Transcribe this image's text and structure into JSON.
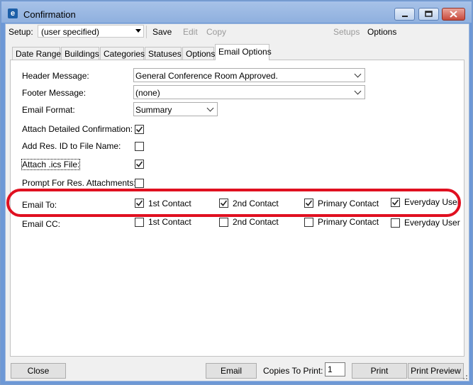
{
  "window": {
    "title": "Confirmation",
    "app_icon": "e",
    "controls": {
      "minimize": "minimize-icon",
      "maximize": "maximize-icon",
      "close": "close-icon"
    }
  },
  "toolbar": {
    "setup_label": "Setup:",
    "setup_value": "(user specified)",
    "save": "Save",
    "edit": "Edit",
    "copy": "Copy",
    "setups": "Setups",
    "options": "Options"
  },
  "tabs": [
    {
      "label": "Date Range",
      "active": false
    },
    {
      "label": "Buildings",
      "active": false
    },
    {
      "label": "Categories",
      "active": false
    },
    {
      "label": "Statuses",
      "active": false
    },
    {
      "label": "Options",
      "active": false
    },
    {
      "label": "Email Options",
      "active": true
    }
  ],
  "form": {
    "header_message": {
      "label": "Header Message:",
      "value": "General Conference Room Approved."
    },
    "footer_message": {
      "label": "Footer Message:",
      "value": "(none)"
    },
    "email_format": {
      "label": "Email Format:",
      "value": "Summary"
    },
    "attach_detailed": {
      "label": "Attach Detailed Confirmation:",
      "checked": true
    },
    "add_res_id": {
      "label": "Add Res. ID to File Name:",
      "checked": false
    },
    "attach_ics": {
      "label": "Attach .ics File:",
      "checked": true
    },
    "prompt_attachments": {
      "label": "Prompt For Res. Attachments:",
      "checked": false
    },
    "email_to": {
      "label": "Email To:",
      "options": [
        {
          "label": "1st Contact",
          "checked": true
        },
        {
          "label": "2nd Contact",
          "checked": true
        },
        {
          "label": "Primary Contact",
          "checked": true
        },
        {
          "label": "Everyday User",
          "checked": true
        }
      ]
    },
    "email_cc": {
      "label": "Email CC:",
      "options": [
        {
          "label": "1st Contact",
          "checked": false
        },
        {
          "label": "2nd Contact",
          "checked": false
        },
        {
          "label": "Primary Contact",
          "checked": false
        },
        {
          "label": "Everyday User",
          "checked": false
        }
      ]
    }
  },
  "footer": {
    "close": "Close",
    "email": "Email",
    "copies_label": "Copies To Print:",
    "copies_value": "1",
    "print": "Print",
    "print_preview": "Print Preview"
  },
  "highlight_color": "#e01020"
}
